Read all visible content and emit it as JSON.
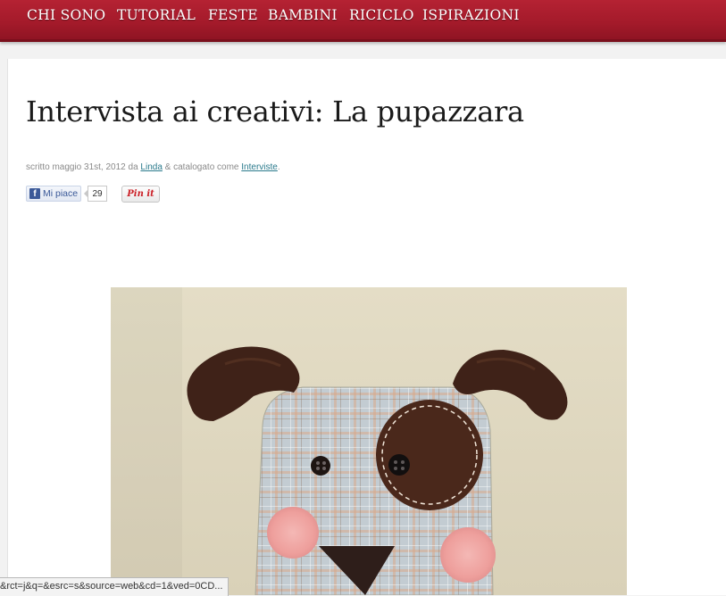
{
  "nav": {
    "items": [
      "CHI SONO",
      "TUTORIAL",
      "FESTE",
      "BAMBINI",
      "RICICLO",
      "ISPIRAZIONI"
    ]
  },
  "post": {
    "title": "Intervista ai creativi: La pupazzara",
    "meta_prefix": "scritto maggio 31st, 2012 da ",
    "author": "Linda",
    "meta_middle": " & catalogato come ",
    "category": "Interviste",
    "meta_suffix": "."
  },
  "social": {
    "fb_logo": "f",
    "fb_label": "Mi piace",
    "fb_count": "29",
    "pin_label": "Pin it"
  },
  "status_bar": {
    "url": "&rct=j&q=&esrc=s&source=web&cd=1&ved=0CD..."
  },
  "colors": {
    "nav_bg": "#a31a2a",
    "link": "#2a7a8c",
    "plush_fabric": "#c3ccd2",
    "plush_brown": "#3f2218",
    "cheek_pink": "#f0a6a4"
  }
}
